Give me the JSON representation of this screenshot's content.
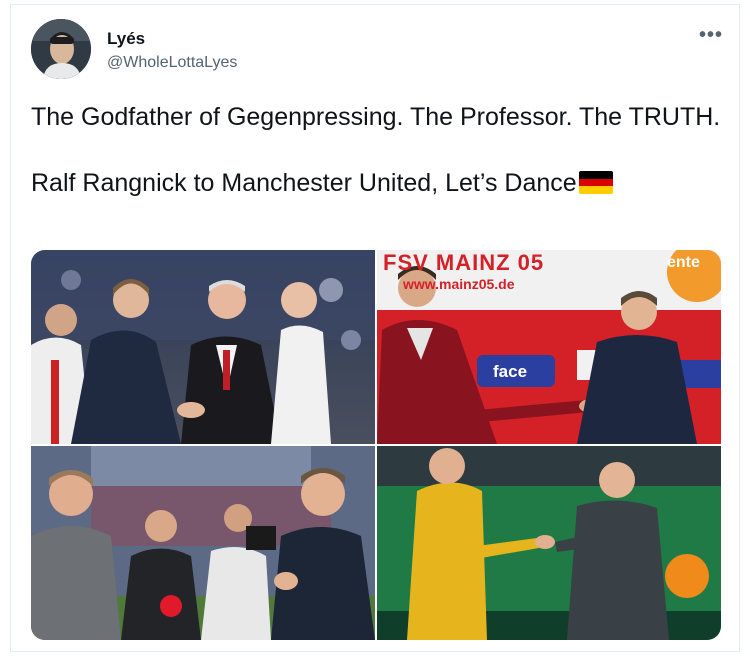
{
  "tweet": {
    "author_name": "Lyés",
    "author_handle": "@WholeLottaLyes",
    "more_label": "•••",
    "text_line1": "The Godfather of Gegenpressing. The Professor. The TRUTH.",
    "text_line2": "Ralf Rangnick to Manchester United, Let’s Dance",
    "flag_icon": "germany-flag-icon"
  },
  "photos": [
    {
      "description_icon": "photo-handshake-stadium"
    },
    {
      "description_icon": "photo-mainz-press-board",
      "board_text_1": "FSV MAINZ 05",
      "board_text_2": "www.mainz05.de",
      "sponsor_1": "face",
      "sponsor_2": "ente"
    },
    {
      "description_icon": "photo-stadium-reporters"
    },
    {
      "description_icon": "photo-handshake-green-pitch"
    }
  ],
  "colors": {
    "text": "#0f1419",
    "secondary": "#536471",
    "border": "#e6ecf0",
    "flag_black": "#000000",
    "flag_red": "#dd0000",
    "flag_gold": "#ffce00"
  }
}
